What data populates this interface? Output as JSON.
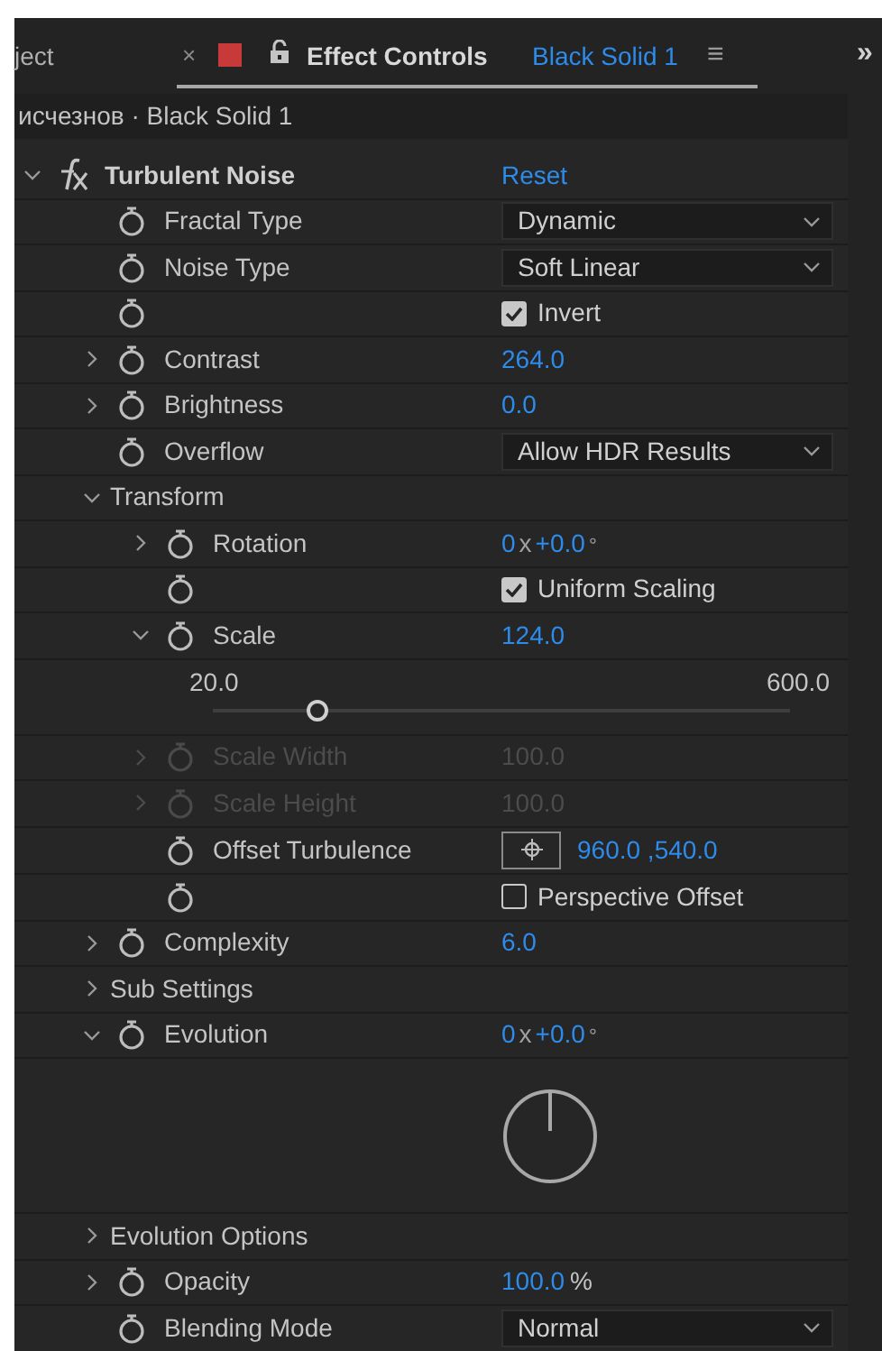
{
  "panel_tabs": {
    "cut_tab": "ject",
    "close": "×",
    "title": "Effect Controls",
    "layer": "Black Solid 1",
    "menu": "≡",
    "overflow": "»"
  },
  "breadcrumb": "исчезнов · Black Solid 1",
  "effects": [
    {
      "name": "Turbulent Noise",
      "expanded": true,
      "reset": "Reset",
      "children": [
        {
          "kind": "dropdown",
          "name": "Fractal Type",
          "value": "Dynamic"
        },
        {
          "kind": "dropdown",
          "name": "Noise Type",
          "value": "Soft Linear"
        },
        {
          "kind": "checkbox",
          "label": "Invert",
          "checked": true
        },
        {
          "kind": "number",
          "name": "Contrast",
          "expanded": false,
          "value": "264.0"
        },
        {
          "kind": "number",
          "name": "Brightness",
          "expanded": false,
          "value": "0.0"
        },
        {
          "kind": "dropdown",
          "name": "Overflow",
          "value": "Allow HDR Results"
        },
        {
          "kind": "group",
          "name": "Transform",
          "expanded": true,
          "children": [
            {
              "kind": "angle",
              "name": "Rotation",
              "expanded": false,
              "turns": "0",
              "times": "x",
              "degrees": "+0.0",
              "unit": "°"
            },
            {
              "kind": "checkbox",
              "label": "Uniform Scaling",
              "checked": true
            },
            {
              "kind": "number",
              "name": "Scale",
              "expanded": true,
              "value": "124.0",
              "slider": {
                "min": "20.0",
                "max": "600.0",
                "level": 0.18
              }
            },
            {
              "kind": "number",
              "name": "Scale Width",
              "expanded": false,
              "disabled": true,
              "value": "100.0"
            },
            {
              "kind": "number",
              "name": "Scale Height",
              "expanded": false,
              "disabled": true,
              "value": "100.0"
            },
            {
              "kind": "point",
              "name": "Offset Turbulence",
              "value": "960.0 ,540.0"
            },
            {
              "kind": "checkbox",
              "label": "Perspective Offset",
              "checked": false
            }
          ]
        },
        {
          "kind": "number",
          "name": "Complexity",
          "expanded": false,
          "value": "6.0"
        },
        {
          "kind": "group",
          "name": "Sub Settings",
          "expanded": false
        },
        {
          "kind": "angle",
          "name": "Evolution",
          "expanded": true,
          "turns": "0",
          "times": "x",
          "degrees": "+0.0",
          "unit": "°"
        },
        {
          "kind": "group",
          "name": "Evolution Options",
          "expanded": false
        },
        {
          "kind": "number",
          "name": "Opacity",
          "expanded": false,
          "value": "100.0",
          "unit": "%"
        },
        {
          "kind": "dropdown",
          "name": "Blending Mode",
          "value": "Normal"
        }
      ]
    }
  ]
}
